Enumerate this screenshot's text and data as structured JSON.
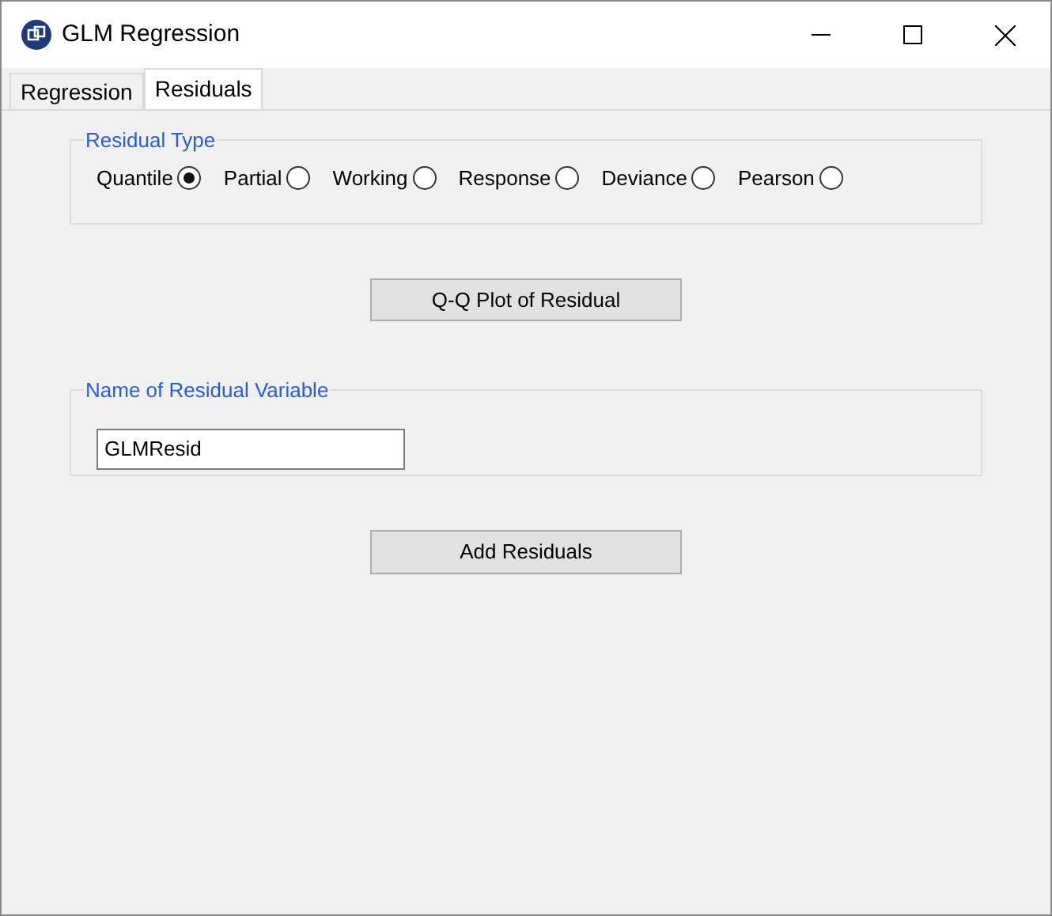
{
  "window": {
    "title": "GLM Regression"
  },
  "tabs": [
    {
      "label": "Regression",
      "selected": false
    },
    {
      "label": "Residuals",
      "selected": true
    }
  ],
  "residual_type": {
    "title": "Residual Type",
    "options": [
      {
        "label": "Quantile",
        "selected": true
      },
      {
        "label": "Partial",
        "selected": false
      },
      {
        "label": "Working",
        "selected": false
      },
      {
        "label": "Response",
        "selected": false
      },
      {
        "label": "Deviance",
        "selected": false
      },
      {
        "label": "Pearson",
        "selected": false
      }
    ]
  },
  "qq_button": "Q-Q Plot of Residual",
  "residual_variable": {
    "title": "Name of Residual Variable",
    "value": "GLMResid"
  },
  "add_button": "Add Residuals"
}
